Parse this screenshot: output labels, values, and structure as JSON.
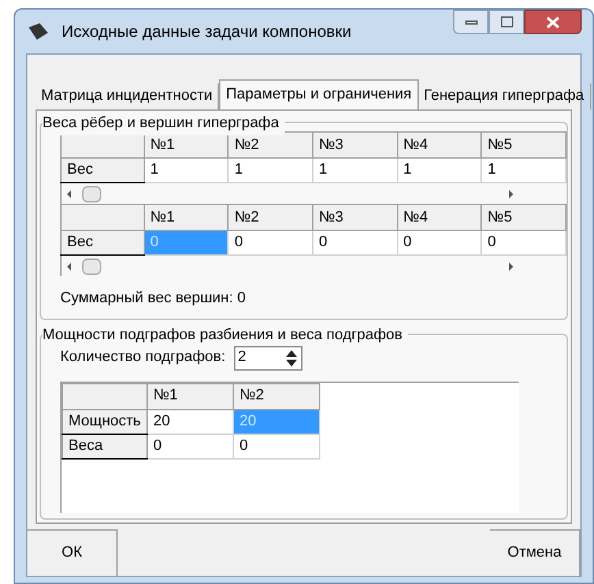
{
  "window": {
    "title": "Исходные данные задачи компоновки"
  },
  "tabs": [
    {
      "label": "Матрица инцидентности",
      "selected": false
    },
    {
      "label": "Параметры и ограничения",
      "selected": true
    },
    {
      "label": "Генерация гиперграфа",
      "selected": false
    }
  ],
  "weights_group": {
    "title": "Веса рёбер и вершин гиперграфа",
    "grids": [
      {
        "columns": [
          "№1",
          "№2",
          "№3",
          "№4",
          "№5"
        ],
        "rows": [
          {
            "header": "Вес",
            "cells": [
              {
                "value": "1",
                "selected": false
              },
              {
                "value": "1",
                "selected": false
              },
              {
                "value": "1",
                "selected": false
              },
              {
                "value": "1",
                "selected": false
              },
              {
                "value": "1",
                "selected": false
              }
            ]
          }
        ]
      },
      {
        "columns": [
          "№1",
          "№2",
          "№3",
          "№4",
          "№5"
        ],
        "rows": [
          {
            "header": "Вес",
            "cells": [
              {
                "value": "0",
                "selected": true
              },
              {
                "value": "0",
                "selected": false
              },
              {
                "value": "0",
                "selected": false
              },
              {
                "value": "0",
                "selected": false
              },
              {
                "value": "0",
                "selected": false
              }
            ]
          }
        ]
      }
    ],
    "total": "Суммарный вес вершин: 0"
  },
  "subgraphs_group": {
    "title": "Мощности подграфов разбиения и веса подграфов",
    "count_label": "Количество подграфов:",
    "count_value": "2",
    "grid": {
      "columns": [
        "№1",
        "№2"
      ],
      "rows": [
        {
          "header": "Мощность",
          "cells": [
            {
              "value": "20",
              "selected": false
            },
            {
              "value": "20",
              "selected": true
            }
          ]
        },
        {
          "header": "Веса",
          "cells": [
            {
              "value": "0",
              "selected": false
            },
            {
              "value": "0",
              "selected": false
            }
          ]
        }
      ]
    }
  },
  "buttons": [
    "ОК",
    "Отмена"
  ]
}
